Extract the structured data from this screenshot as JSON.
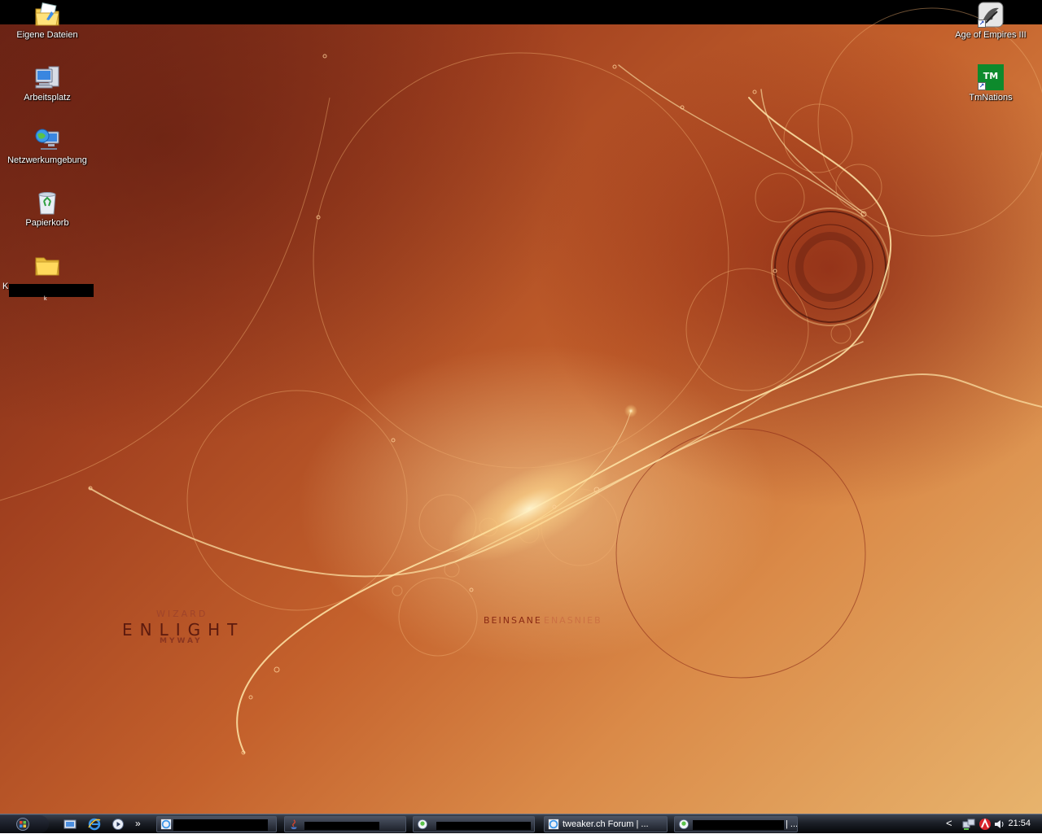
{
  "desktop": {
    "icons_left": [
      {
        "label": "Eigene Dateien",
        "icon": "my-documents-icon"
      },
      {
        "label": "Arbeitsplatz",
        "icon": "my-computer-icon"
      },
      {
        "label": "Netzwerkumgebung",
        "icon": "network-places-icon"
      },
      {
        "label": "Papierkorb",
        "icon": "recycle-bin-icon"
      },
      {
        "label": "K",
        "label_second_line": "k",
        "icon": "folder-icon"
      }
    ],
    "icons_right": [
      {
        "label": "Age of Empires III",
        "icon": "age-of-empires-icon"
      },
      {
        "label": "TmNations",
        "icon": "tmnations-icon"
      }
    ]
  },
  "wallpaper": {
    "text_wizard": "WIZARD",
    "text_enlight": "ENLIGHT",
    "text_myway": "MYWAY",
    "text_beinsane": "BEINSANE",
    "text_beinsane_mirror": "ENASNIEB"
  },
  "taskbar": {
    "quick_launch": [
      "show-desktop-icon",
      "internet-explorer-icon",
      "media-player-icon"
    ],
    "overflow_label": "»",
    "tasks": [
      {
        "label": "",
        "icon": "internet-explorer-icon",
        "redacted": true
      },
      {
        "label": "",
        "icon": "java-icon",
        "redacted": true
      },
      {
        "label": "",
        "icon": "messenger-icon",
        "redacted": true
      },
      {
        "label": "tweaker.ch Forum | ...",
        "icon": "internet-explorer-icon",
        "redacted": false
      },
      {
        "label": "| ...",
        "icon": "messenger-icon",
        "redacted": true
      }
    ],
    "tray_expand_label": "<",
    "clock": "21:54"
  }
}
